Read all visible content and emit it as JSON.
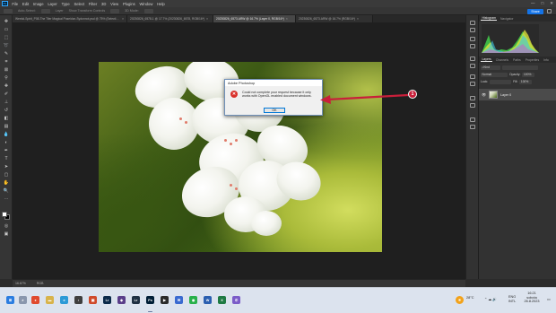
{
  "menu": {
    "logo": "Ps",
    "items": [
      "File",
      "Edit",
      "Image",
      "Layer",
      "Type",
      "Select",
      "Filter",
      "3D",
      "View",
      "Plugins",
      "Window",
      "Help"
    ],
    "controls": [
      "—",
      "□",
      "✕"
    ]
  },
  "options": {
    "labels": [
      "Auto-Select:",
      "Layer",
      "Show Transform Controls",
      "3D Mode:"
    ],
    "share_label": "Share"
  },
  "tabs": [
    {
      "label": "Weekd-Spirit_P08-The Tiler Magical Poseidon-Sydonnot.psd @ 75% (Selective Color 2, Layer Mask/8)",
      "active": false
    },
    {
      "label": "20230826_6578-1 @ 17.7% (20230826_6578, RGB/16*)",
      "active": false
    },
    {
      "label": "20230826_6573.ARW @ 16.7% (Layer 0, RGB/16*)",
      "active": true
    },
    {
      "label": "20230826_6573.ARW @ 16.7% (RGB/16*)",
      "active": false
    }
  ],
  "status": {
    "zoom": "16.67%",
    "info": "RGB"
  },
  "dialog": {
    "title": "Adobe Photoshop",
    "icon": "error-icon",
    "message": "Could not complete your request because it only works with OpenGL enabled document windows.",
    "ok_label": "OK"
  },
  "callout": {
    "number": "1",
    "color": "#c91f3a"
  },
  "panels": {
    "histogram_tabs": [
      "Histogram",
      "Navigator"
    ],
    "layers_tabs": [
      "Layers",
      "Channels",
      "Paths",
      "Properties",
      "Info"
    ],
    "kind_label": "Kind",
    "blend_mode": "Normal",
    "opacity_label": "Opacity:",
    "opacity_value": "100%",
    "lock_label": "Lock:",
    "fill_label": "Fill:",
    "fill_value": "100%",
    "layer_name": "Layer 0"
  },
  "taskbar": {
    "weather_temp": "28°C",
    "weather_desc": "Sunny",
    "lang_top": "ENG",
    "lang_bottom": "INTL",
    "time": "16:21",
    "day": "sobota",
    "date": "26.8.2023"
  },
  "colors": {
    "accent": "#1473e6",
    "ps_blue": "#31a8ff",
    "callout_red": "#c91f3a",
    "error_red": "#d9302a"
  }
}
